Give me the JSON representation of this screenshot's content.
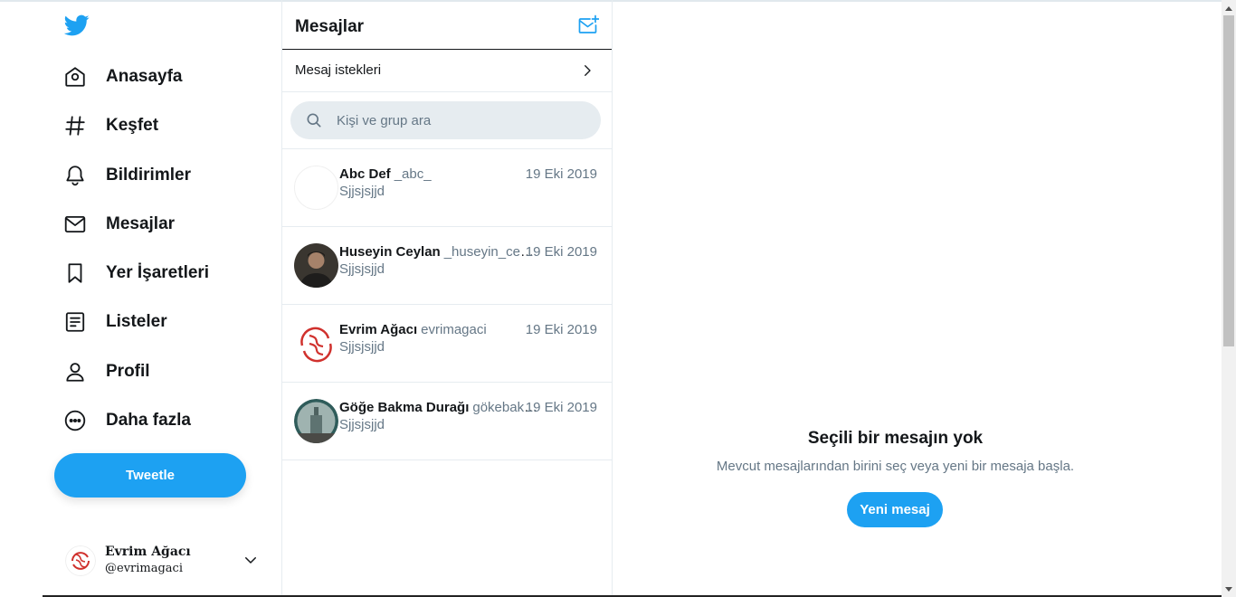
{
  "colors": {
    "accent": "#1da1f2",
    "text": "#14171a",
    "muted": "#657786",
    "divider": "#e6ecf0"
  },
  "nav": {
    "logo_icon": "twitter-bird-icon",
    "items": [
      {
        "label": "Anasayfa",
        "icon": "home-icon"
      },
      {
        "label": "Keşfet",
        "icon": "hashtag-icon"
      },
      {
        "label": "Bildirimler",
        "icon": "bell-icon"
      },
      {
        "label": "Mesajlar",
        "icon": "envelope-icon"
      },
      {
        "label": "Yer İşaretleri",
        "icon": "bookmark-icon"
      },
      {
        "label": "Listeler",
        "icon": "list-icon"
      },
      {
        "label": "Profil",
        "icon": "person-icon"
      },
      {
        "label": "Daha fazla",
        "icon": "more-circle-icon"
      }
    ],
    "tweet_button": "Tweetle",
    "account": {
      "name": "Evrim Ağacı",
      "handle": "@evrimagaci"
    }
  },
  "messages": {
    "title": "Mesajlar",
    "requests_label": "Mesaj istekleri",
    "search_placeholder": "Kişi ve grup ara",
    "conversations": [
      {
        "name": "Abc Def",
        "handle": "_abc_",
        "date": "19 Eki 2019",
        "preview": "Sjjsjsjjd"
      },
      {
        "name": "Huseyin Ceylan",
        "handle": "_huseyin_ceylan_",
        "date": "19 Eki 2019",
        "preview": "Sjjsjsjjd"
      },
      {
        "name": "Evrim Ağacı",
        "handle": "evrimagaci",
        "date": "19 Eki 2019",
        "preview": "Sjjsjsjjd"
      },
      {
        "name": "Göğe Bakma Durağı",
        "handle": "gökebakmadurağı",
        "date": "19 Eki 2019",
        "preview": "Sjjsjsjjd"
      }
    ]
  },
  "empty_state": {
    "title": "Seçili bir mesajın yok",
    "subtitle": "Mevcut mesajlarından birini seç veya yeni bir mesaja başla.",
    "button": "Yeni mesaj"
  }
}
